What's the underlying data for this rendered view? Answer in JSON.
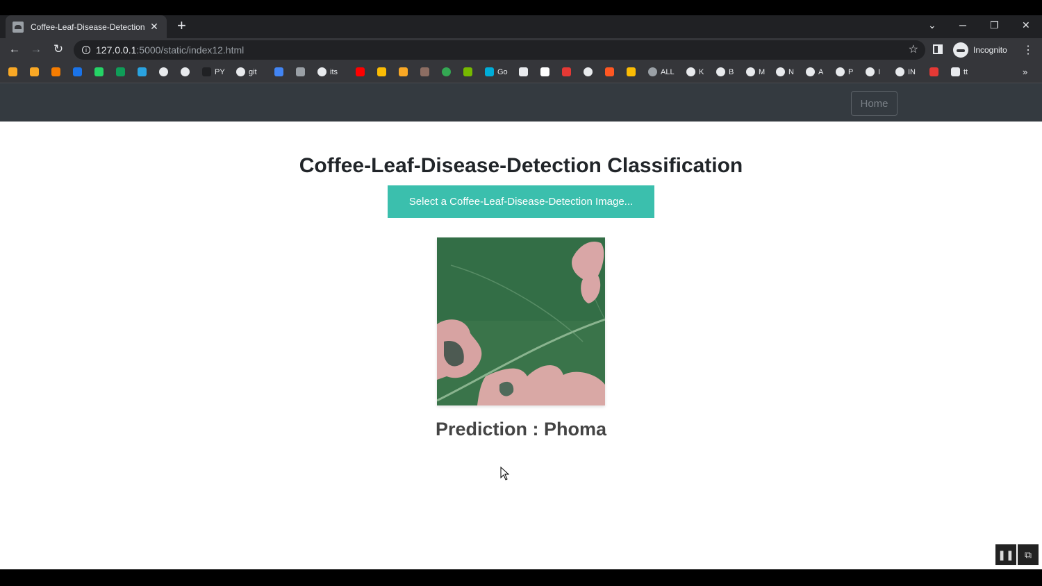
{
  "browser": {
    "tab_title": "Coffee-Leaf-Disease-Detection",
    "tab_close": "✕",
    "new_tab": "+",
    "url_host": "127.0.0.1",
    "url_path": ":5000/static/index12.html",
    "profile_label": "Incognito",
    "win_minimize": "─",
    "win_restore": "❐",
    "win_close": "✕",
    "tab_search": "⌄",
    "back": "←",
    "forward": "→",
    "reload": "↻",
    "star": "☆",
    "menu": "⋮",
    "bookmarks_more": "»",
    "bookmarks": [
      {
        "label": "",
        "color": "#f9a825",
        "icon": "arrow-icon"
      },
      {
        "label": "",
        "color": "#f9a825",
        "icon": "badge-icon"
      },
      {
        "label": "",
        "color": "#f57c00",
        "icon": "analytics-icon"
      },
      {
        "label": "",
        "color": "#1a73e8",
        "icon": "ieee-icon"
      },
      {
        "label": "",
        "color": "#25d366",
        "icon": "whatsapp-icon"
      },
      {
        "label": "",
        "color": "#0f9d58",
        "icon": "sheets-icon"
      },
      {
        "label": "",
        "color": "#2aa3e0",
        "icon": "telegram-icon"
      },
      {
        "label": "",
        "color": "#e8eaed",
        "icon": "google-icon"
      },
      {
        "label": "",
        "color": "#e8eaed",
        "icon": "google-icon"
      },
      {
        "label": "PY",
        "color": "#202124",
        "icon": "github-icon"
      },
      {
        "label": "git",
        "color": "#e8eaed",
        "icon": "google-icon"
      },
      {
        "label": "",
        "color": "#4285f4",
        "icon": "doc-icon"
      },
      {
        "label": "",
        "color": "#9aa0a6",
        "icon": "car-icon"
      },
      {
        "label": "its",
        "color": "#e8eaed",
        "icon": "google-icon"
      },
      {
        "label": "",
        "color": "#ff0000",
        "icon": "youtube-icon"
      },
      {
        "label": "",
        "color": "#fbbc04",
        "icon": "p-icon"
      },
      {
        "label": "",
        "color": "#f9a825",
        "icon": "cats-icon"
      },
      {
        "label": "",
        "color": "#8d6e63",
        "icon": "shield-icon"
      },
      {
        "label": "",
        "color": "#34a853",
        "icon": "circle-icon"
      },
      {
        "label": "",
        "color": "#76b900",
        "icon": "nvidia-icon"
      },
      {
        "label": "Go",
        "color": "#00add8",
        "icon": "go-icon"
      },
      {
        "label": "",
        "color": "#e8eaed",
        "icon": "image-icon"
      },
      {
        "label": "",
        "color": "#ffffff",
        "icon": "cl-icon"
      },
      {
        "label": "",
        "color": "#e53935",
        "icon": "yandex-icon"
      },
      {
        "label": "",
        "color": "#e8eaed",
        "icon": "google-icon"
      },
      {
        "label": "",
        "color": "#ff5722",
        "icon": "spark-icon"
      },
      {
        "label": "",
        "color": "#fbbc04",
        "icon": "tag-icon"
      },
      {
        "label": "ALL",
        "color": "#9aa0a6",
        "icon": "globe-icon"
      },
      {
        "label": "K",
        "color": "#e8eaed",
        "icon": "google-icon"
      },
      {
        "label": "B",
        "color": "#e8eaed",
        "icon": "google-icon"
      },
      {
        "label": "M",
        "color": "#e8eaed",
        "icon": "google-icon"
      },
      {
        "label": "N",
        "color": "#e8eaed",
        "icon": "google-icon"
      },
      {
        "label": "A",
        "color": "#e8eaed",
        "icon": "google-icon"
      },
      {
        "label": "P",
        "color": "#e8eaed",
        "icon": "google-icon"
      },
      {
        "label": "I",
        "color": "#e8eaed",
        "icon": "google-icon"
      },
      {
        "label": "IN",
        "color": "#e8eaed",
        "icon": "google-icon"
      },
      {
        "label": "",
        "color": "#e53935",
        "icon": "bookmark-icon"
      },
      {
        "label": "tt",
        "color": "#e8eaed",
        "icon": "monitor-icon"
      }
    ]
  },
  "navbar": {
    "home_label": "Home"
  },
  "main": {
    "title": "Coffee-Leaf-Disease-Detection Classification",
    "upload_label": "Select a Coffee-Leaf-Disease-Detection Image...",
    "prediction": "Prediction : Phoma"
  },
  "player": {
    "pause": "❚❚",
    "pip": "⧉"
  },
  "colors": {
    "navbar_bg": "#343a40",
    "accent_button": "#3bbfad",
    "page_bg": "#ffffff"
  }
}
